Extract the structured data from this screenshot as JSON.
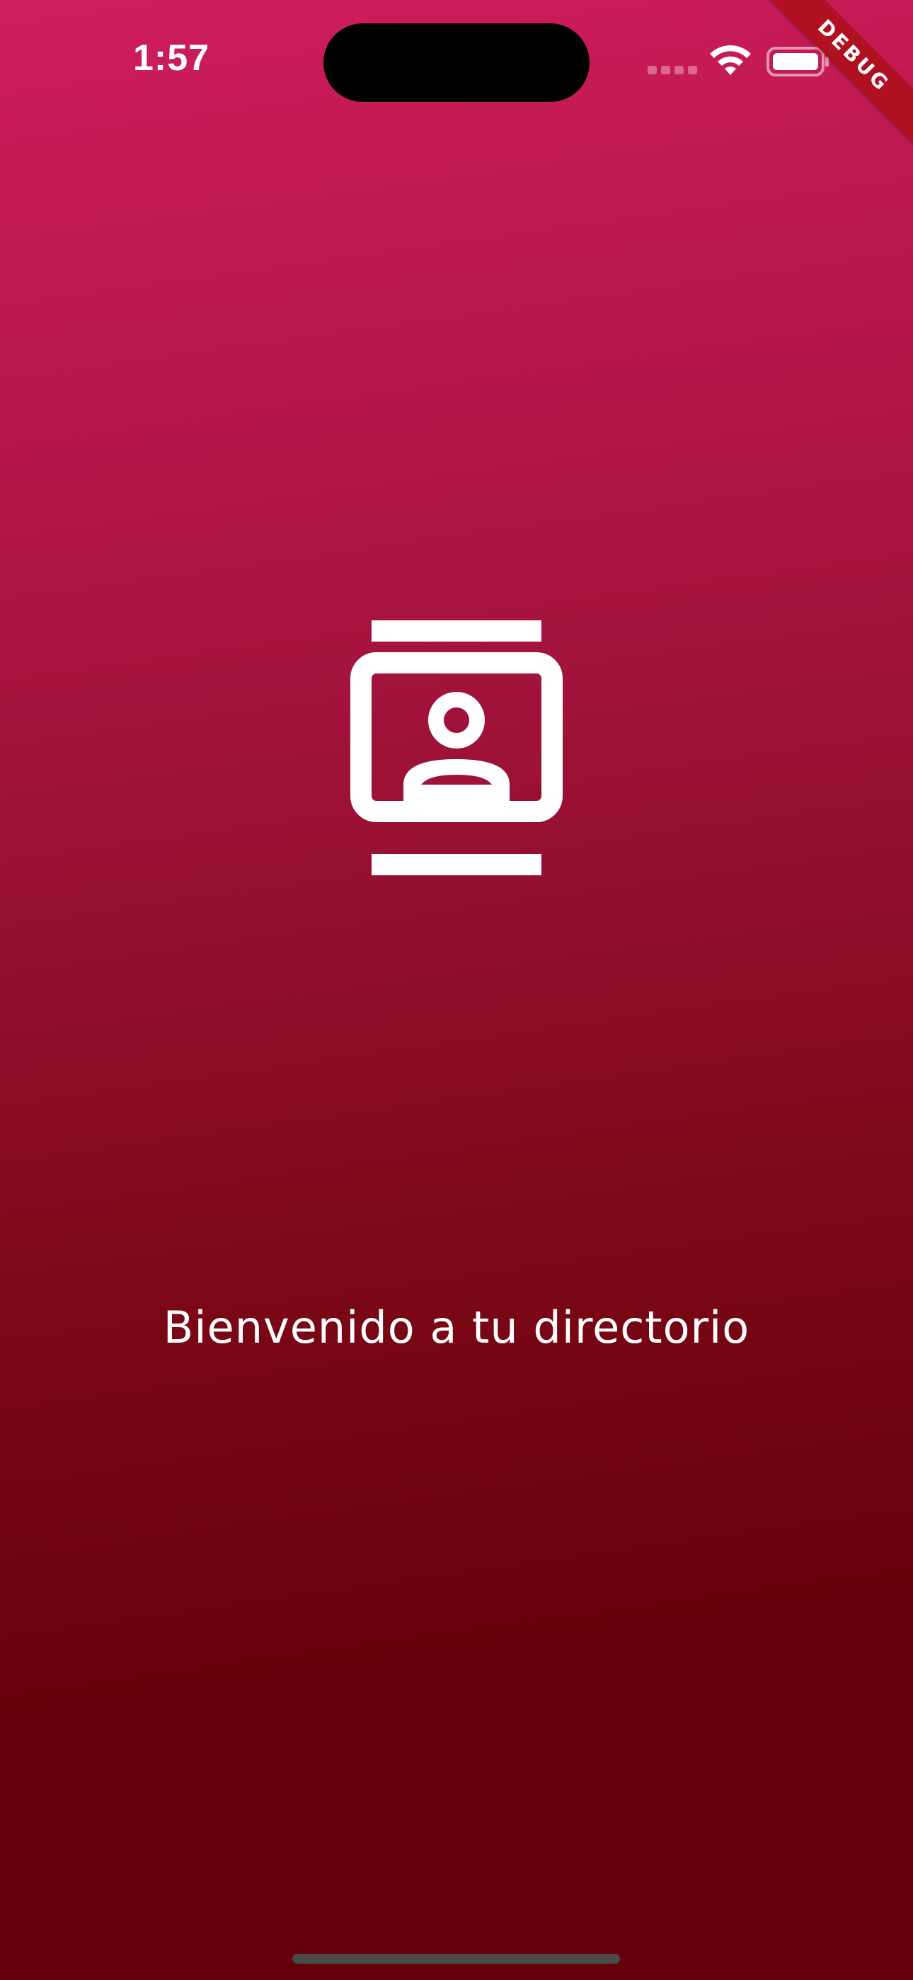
{
  "status_bar": {
    "time": "1:57"
  },
  "debug_banner": {
    "label": "DEBUG"
  },
  "main": {
    "icon": "contacts-icon",
    "welcome_text": "Bienvenido a tu directorio"
  },
  "colors": {
    "gradient_top": "#cf1c5e",
    "gradient_bottom": "#630008",
    "debug_banner": "#b0101f",
    "text": "#ffffff"
  }
}
